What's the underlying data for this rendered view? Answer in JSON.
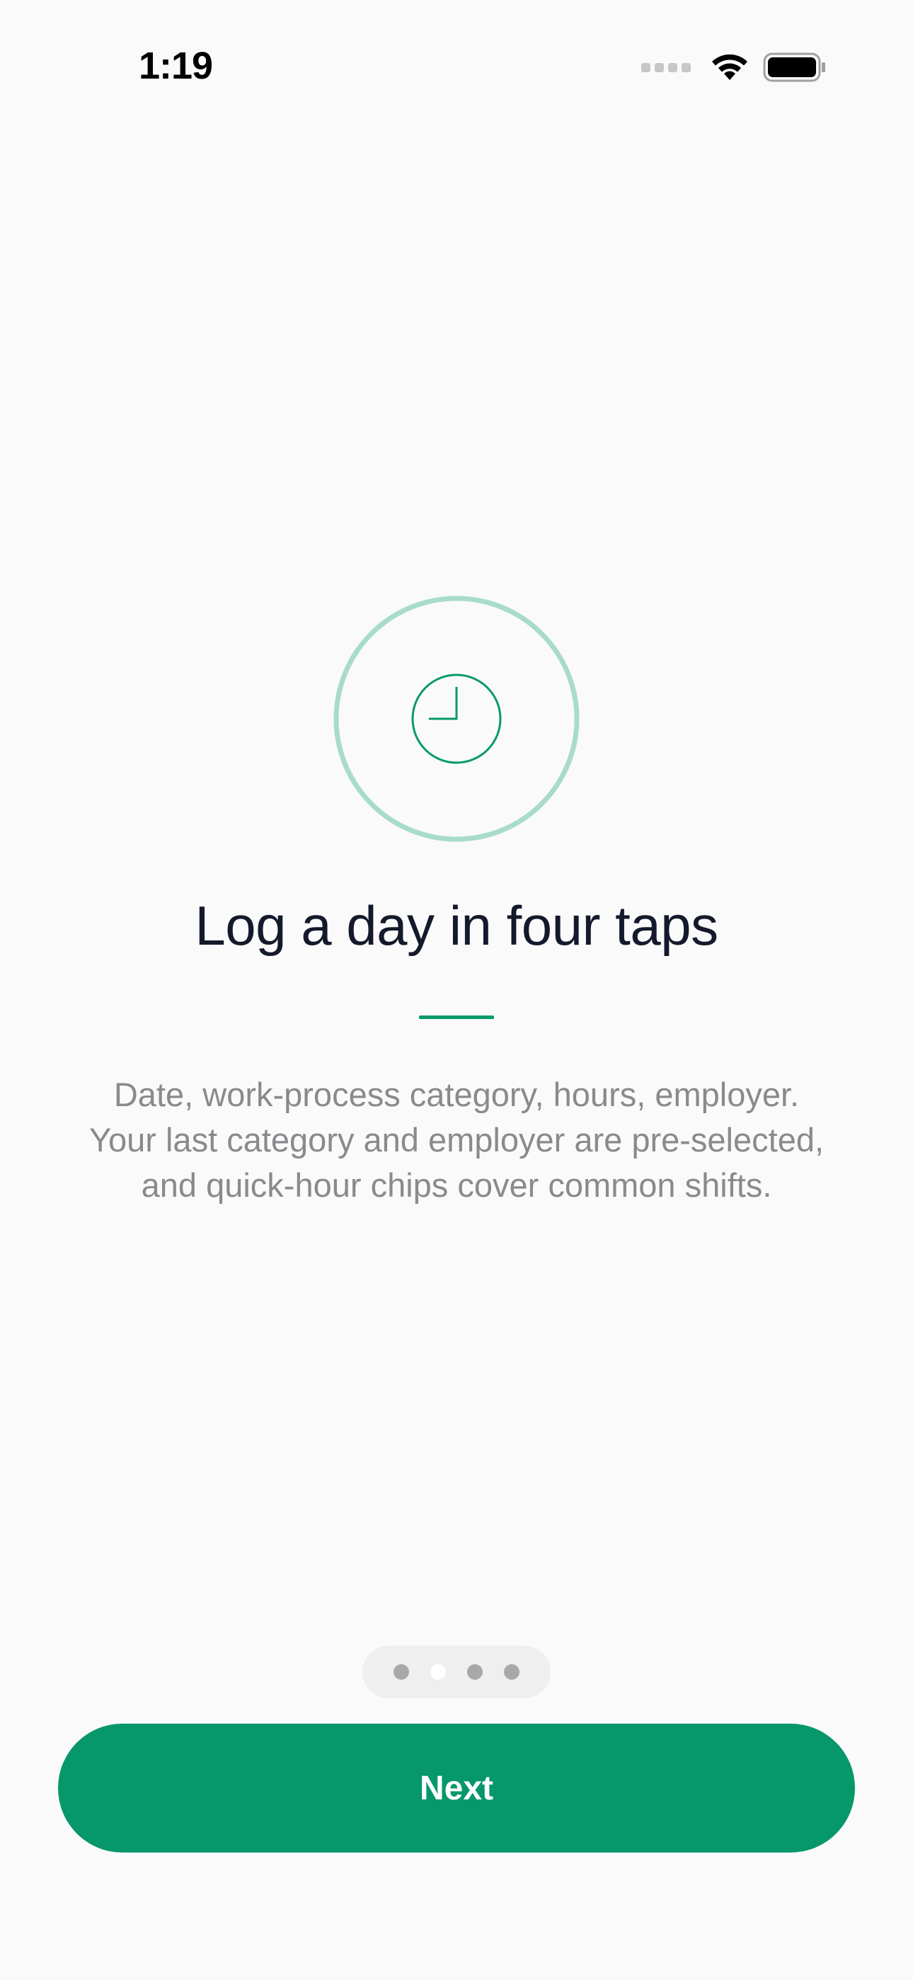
{
  "status_bar": {
    "time": "1:19",
    "icons": [
      "cellular-signal-icon",
      "wifi-icon",
      "battery-icon"
    ]
  },
  "onboarding": {
    "icon": "clock-icon",
    "title": "Log a day in four taps",
    "description": "Date, work-process category, hours, employer. Your last category and employer are pre-selected, and quick-hour chips cover common shifts.",
    "page_count": 4,
    "current_page": 2
  },
  "actions": {
    "next_label": "Next"
  },
  "colors": {
    "accent": "#06976a",
    "ring": "#a8dcc8",
    "background": "#fafafa",
    "body_text": "#8a8a8e"
  }
}
